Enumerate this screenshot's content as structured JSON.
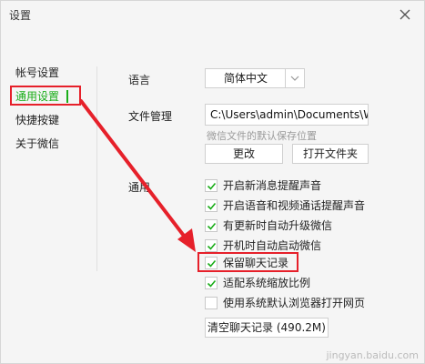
{
  "window": {
    "title": "设置"
  },
  "sidebar": {
    "items": [
      {
        "label": "帐号设置",
        "active": false
      },
      {
        "label": "通用设置",
        "active": true
      },
      {
        "label": "快捷按键",
        "active": false
      },
      {
        "label": "关于微信",
        "active": false
      }
    ]
  },
  "language": {
    "label": "语言",
    "value": "简体中文"
  },
  "file_management": {
    "label": "文件管理",
    "path": "C:\\Users\\admin\\Documents\\W",
    "hint": "微信文件的默认保存位置",
    "change_button": "更改",
    "open_folder_button": "打开文件夹"
  },
  "general": {
    "label": "通用",
    "options": [
      {
        "label": "开启新消息提醒声音",
        "checked": true
      },
      {
        "label": "开启语音和视频通话提醒声音",
        "checked": true
      },
      {
        "label": "有更新时自动升级微信",
        "checked": true
      },
      {
        "label": "开机时自动启动微信",
        "checked": true
      },
      {
        "label": "保留聊天记录",
        "checked": true
      },
      {
        "label": "适配系统缩放比例",
        "checked": true
      },
      {
        "label": "使用系统默认浏览器打开网页",
        "checked": false
      }
    ],
    "clear_button": "清空聊天记录 (490.2M)"
  },
  "colors": {
    "accent": "#1aad19",
    "annotation": "#e6202a"
  },
  "watermark": "jingyan.baidu.com"
}
